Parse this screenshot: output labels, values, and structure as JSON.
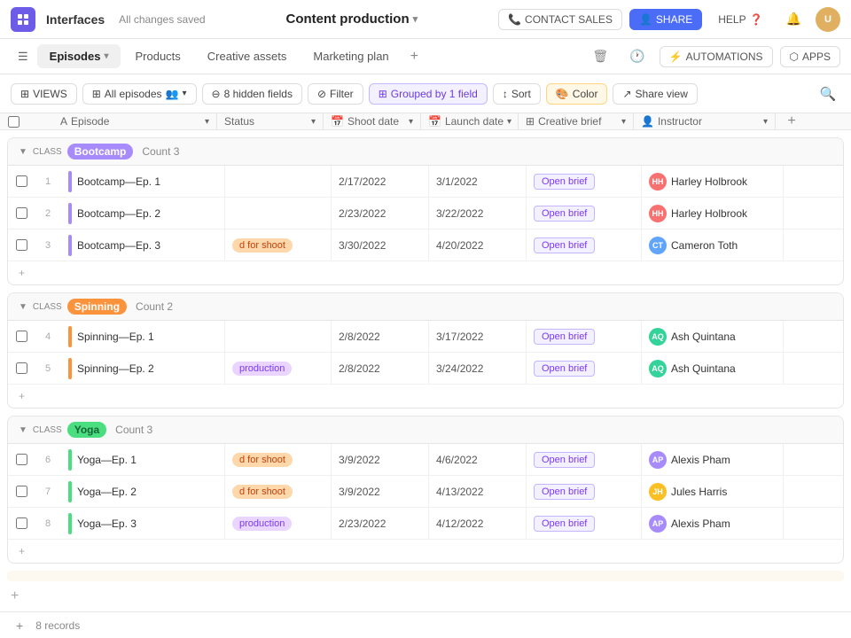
{
  "topNav": {
    "appName": "Interfaces",
    "savedStatus": "All changes saved",
    "pageTitle": "Content production",
    "contactSales": "CONTACT SALES",
    "share": "SHARE",
    "help": "HELP"
  },
  "secondNav": {
    "tabs": [
      {
        "id": "episodes",
        "label": "Episodes",
        "active": true
      },
      {
        "id": "products",
        "label": "Products",
        "active": false
      },
      {
        "id": "creative-assets",
        "label": "Creative assets",
        "active": false
      },
      {
        "id": "marketing-plan",
        "label": "Marketing plan",
        "active": false
      }
    ],
    "automations": "AUTOMATIONS",
    "apps": "APPS"
  },
  "toolbar": {
    "views": "VIEWS",
    "allEpisodes": "All episodes",
    "hiddenFields": "8 hidden fields",
    "filter": "Filter",
    "grouped": "Grouped by 1 field",
    "sort": "Sort",
    "color": "Color",
    "shareView": "Share view"
  },
  "columns": {
    "episode": "Episode",
    "status": "Status",
    "shootDate": "Shoot date",
    "launchDate": "Launch date",
    "creativeBrief": "Creative brief",
    "instructor": "Instructor"
  },
  "groups": [
    {
      "id": "bootcamp",
      "class": "CLASS",
      "name": "Bootcamp",
      "tagClass": "tag-bootcamp",
      "barClass": "bar-purple",
      "count": 3,
      "countLabel": "Count 3",
      "rows": [
        {
          "num": 1,
          "episode": "Bootcamp—Ep. 1",
          "status": "",
          "statusClass": "",
          "shootDate": "2/17/2022",
          "launchDate": "3/1/2022",
          "brief": "Open brief",
          "instructor": "Harley Holbrook",
          "avatarClass": "av-harley",
          "avatarText": "HH"
        },
        {
          "num": 2,
          "episode": "Bootcamp—Ep. 2",
          "status": "",
          "statusClass": "",
          "shootDate": "2/23/2022",
          "launchDate": "3/22/2022",
          "brief": "Open brief",
          "instructor": "Harley Holbrook",
          "avatarClass": "av-harley",
          "avatarText": "HH"
        },
        {
          "num": 3,
          "episode": "Bootcamp—Ep. 3",
          "status": "d for shoot",
          "statusClass": "status-shoot",
          "shootDate": "3/30/2022",
          "launchDate": "4/20/2022",
          "brief": "Open brief",
          "instructor": "Cameron Toth",
          "avatarClass": "av-cameron",
          "avatarText": "CT"
        }
      ]
    },
    {
      "id": "spinning",
      "class": "CLASS",
      "name": "Spinning",
      "tagClass": "tag-spinning",
      "barClass": "bar-orange",
      "count": 2,
      "countLabel": "Count 2",
      "rows": [
        {
          "num": 4,
          "episode": "Spinning—Ep. 1",
          "status": "",
          "statusClass": "",
          "shootDate": "2/8/2022",
          "launchDate": "3/17/2022",
          "brief": "Open brief",
          "instructor": "Ash Quintana",
          "avatarClass": "av-ash",
          "avatarText": "AQ"
        },
        {
          "num": 5,
          "episode": "Spinning—Ep. 2",
          "status": "production",
          "statusClass": "status-production",
          "shootDate": "2/8/2022",
          "launchDate": "3/24/2022",
          "brief": "Open brief",
          "instructor": "Ash Quintana",
          "avatarClass": "av-ash",
          "avatarText": "AQ"
        }
      ]
    },
    {
      "id": "yoga",
      "class": "CLASS",
      "name": "Yoga",
      "tagClass": "tag-yoga",
      "barClass": "bar-green",
      "count": 3,
      "countLabel": "Count 3",
      "rows": [
        {
          "num": 6,
          "episode": "Yoga—Ep. 1",
          "status": "d for shoot",
          "statusClass": "status-shoot",
          "shootDate": "3/9/2022",
          "launchDate": "4/6/2022",
          "brief": "Open brief",
          "instructor": "Alexis Pham",
          "avatarClass": "av-alexis",
          "avatarText": "AP"
        },
        {
          "num": 7,
          "episode": "Yoga—Ep. 2",
          "status": "d for shoot",
          "statusClass": "status-shoot",
          "shootDate": "3/9/2022",
          "launchDate": "4/13/2022",
          "brief": "Open brief",
          "instructor": "Jules Harris",
          "avatarClass": "av-jules",
          "avatarText": "JH"
        },
        {
          "num": 8,
          "episode": "Yoga—Ep. 3",
          "status": "production",
          "statusClass": "status-production",
          "shootDate": "2/23/2022",
          "launchDate": "4/12/2022",
          "brief": "Open brief",
          "instructor": "Alexis Pham",
          "avatarClass": "av-alexis",
          "avatarText": "AP"
        }
      ]
    }
  ],
  "footer": {
    "recordsCount": "8 records",
    "addRecord": "+"
  }
}
